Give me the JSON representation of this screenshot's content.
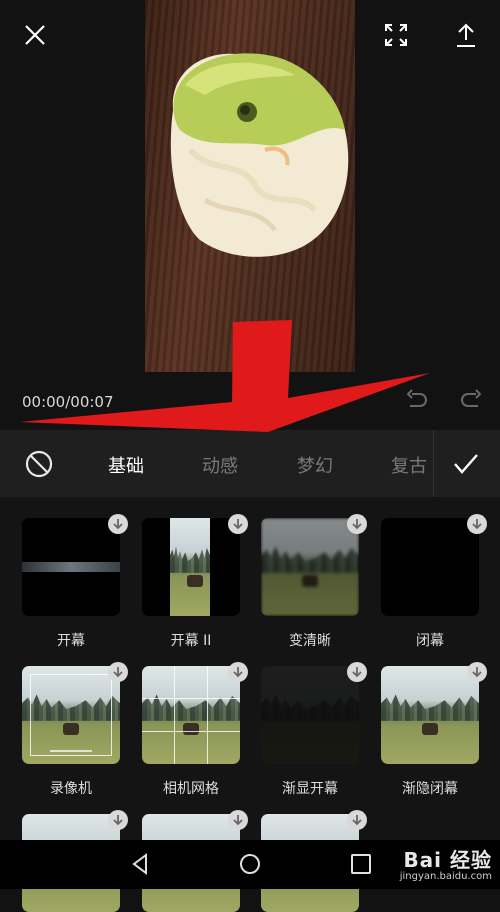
{
  "top_bar": {
    "close_icon": "close-icon",
    "fullscreen_icon": "fullscreen-icon",
    "export_icon": "export-icon"
  },
  "player": {
    "timecode": "00:00/00:07",
    "undo_icon": "undo-icon",
    "redo_icon": "redo-icon"
  },
  "tabs": [
    {
      "label": "基础",
      "active": true
    },
    {
      "label": "动感",
      "active": false
    },
    {
      "label": "梦幻",
      "active": false
    },
    {
      "label": "复古",
      "active": false
    }
  ],
  "effects": [
    {
      "label": "开幕"
    },
    {
      "label": "开幕 II"
    },
    {
      "label": "变清晰"
    },
    {
      "label": "闭幕"
    },
    {
      "label": "录像机"
    },
    {
      "label": "相机网格"
    },
    {
      "label": "渐显开幕"
    },
    {
      "label": "渐隐闭幕"
    }
  ],
  "watermark": {
    "main": "Bai 经验",
    "sub": "jingyan.baidu.com"
  },
  "colors": {
    "background": "#121212",
    "tabbar": "#1f1f1f",
    "annotation_arrow": "#e01a1a"
  }
}
